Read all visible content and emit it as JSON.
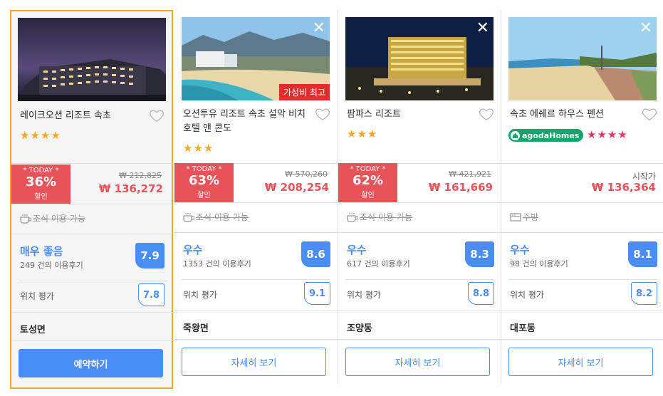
{
  "colors": {
    "accent": "#4a8ef5",
    "sale": "#e8535a",
    "highlight": "#f6a623",
    "agoda": "#14a56b"
  },
  "close_icon": "✕",
  "hotels": [
    {
      "name": "레이크오션 리조트 속초",
      "stars": "★★★★",
      "today_label": "* TODAY *",
      "discount": "36%",
      "discount_label": "할인",
      "original_price": "₩ 212,825",
      "price": "₩ 136,272",
      "amenity": "조식 이용 가능",
      "rating_label": "매우 좋음",
      "review_count": "249 건의 이용후기",
      "score": "7.9",
      "location_label": "위치 평가",
      "location_score": "7.8",
      "area": "토성면",
      "button": "예약하기"
    },
    {
      "name": "오션투유 리조트 속초 설악 비치 호텔 앤 콘도",
      "badge": "가성비 최고",
      "stars": "★★★",
      "today_label": "* TODAY *",
      "discount": "63%",
      "discount_label": "할인",
      "original_price": "₩ 570,260",
      "price": "₩ 208,254",
      "amenity": "조식 이용 가능",
      "rating_label": "우수",
      "review_count": "1353 건의 이용후기",
      "score": "8.6",
      "location_label": "위치 평가",
      "location_score": "9.1",
      "area": "죽왕면",
      "button": "자세히 보기"
    },
    {
      "name": "팜파스 리조트",
      "stars": "★★★",
      "today_label": "* TODAY *",
      "discount": "62%",
      "discount_label": "할인",
      "original_price": "₩ 421,921",
      "price": "₩ 161,669",
      "amenity": "조식 이용 가능",
      "rating_label": "우수",
      "review_count": "617 건의 이용후기",
      "score": "8.3",
      "location_label": "위치 평가",
      "location_score": "8.8",
      "area": "조양동",
      "button": "자세히 보기"
    },
    {
      "name": "속초 에쉐르 하우스 펜션",
      "agoda_badge": "agodaHomes",
      "stars": "★★★★",
      "from_label": "시작가",
      "price": "₩ 136,364",
      "amenity": "주방",
      "rating_label": "우수",
      "review_count": "98 건의 이용후기",
      "score": "8.1",
      "location_label": "위치 평가",
      "location_score": "8.2",
      "area": "대포동",
      "button": "자세히 보기"
    }
  ]
}
